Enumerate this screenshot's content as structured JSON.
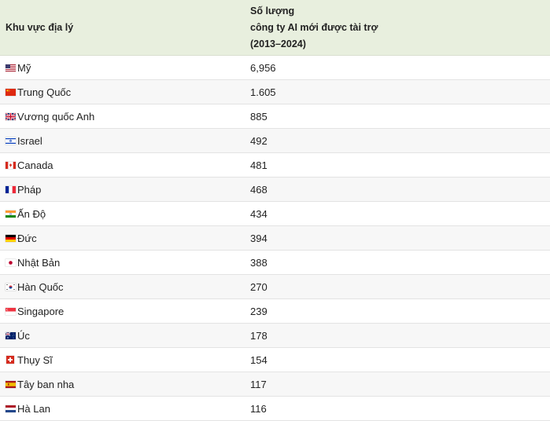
{
  "header": {
    "col1": "Khu vực địa lý",
    "col2_line1": "Số lượng",
    "col2_line2": "công ty AI mới được tài trợ",
    "col2_line3": "(2013–2024)"
  },
  "rows": [
    {
      "country": "Mỹ",
      "value": "6,956",
      "flag_icon": "us-flag-icon"
    },
    {
      "country": "Trung Quốc",
      "value": "1.605",
      "flag_icon": "china-flag-icon"
    },
    {
      "country": "Vương quốc Anh",
      "value": "885",
      "flag_icon": "uk-flag-icon"
    },
    {
      "country": "Israel",
      "value": "492",
      "flag_icon": "israel-flag-icon"
    },
    {
      "country": "Canada",
      "value": "481",
      "flag_icon": "canada-flag-icon"
    },
    {
      "country": "Pháp",
      "value": "468",
      "flag_icon": "france-flag-icon"
    },
    {
      "country": "Ấn Độ",
      "value": "434",
      "flag_icon": "india-flag-icon"
    },
    {
      "country": "Đức",
      "value": "394",
      "flag_icon": "germany-flag-icon"
    },
    {
      "country": "Nhật Bản",
      "value": "388",
      "flag_icon": "japan-flag-icon"
    },
    {
      "country": "Hàn Quốc",
      "value": "270",
      "flag_icon": "south-korea-flag-icon"
    },
    {
      "country": "Singapore",
      "value": "239",
      "flag_icon": "singapore-flag-icon"
    },
    {
      "country": "Úc",
      "value": "178",
      "flag_icon": "australia-flag-icon"
    },
    {
      "country": "Thụy Sĩ",
      "value": "154",
      "flag_icon": "switzerland-flag-icon"
    },
    {
      "country": "Tây ban nha",
      "value": "117",
      "flag_icon": "spain-flag-icon"
    },
    {
      "country": "Hà Lan",
      "value": "116",
      "flag_icon": "netherlands-flag-icon"
    }
  ],
  "colors": {
    "header_bg": "#e8efde",
    "row_alt_bg": "#f7f7f7",
    "border": "#e3e3e3"
  }
}
